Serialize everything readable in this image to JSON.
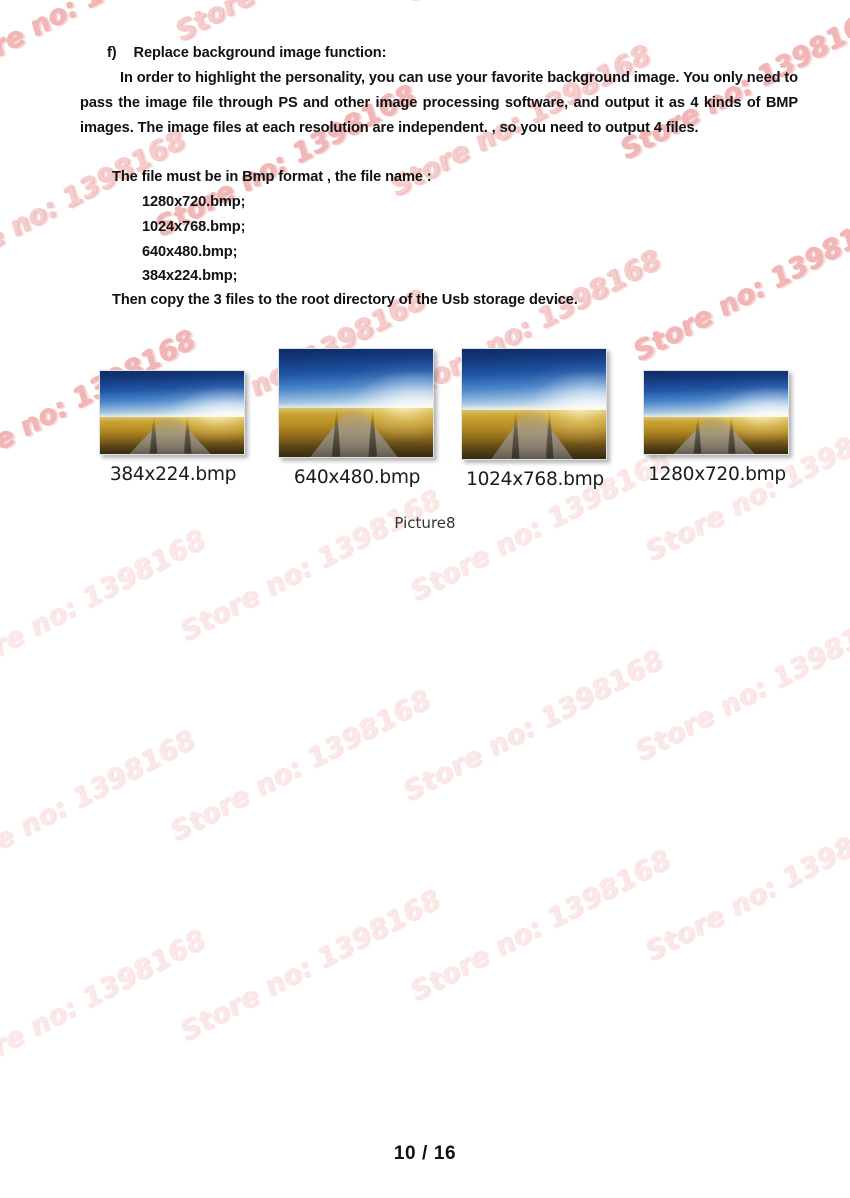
{
  "document": {
    "section_marker": "f)",
    "section_title": "Replace background image function:",
    "paragraph_1": "In order to highlight the personality, you can use your favorite background image. You only need to pass the image file through PS and other image processing software, and output it as 4 kinds of BMP images. The image files at each resolution are independent. , so you need to output 4 files.",
    "file_format_line": "The file must be in Bmp format , the file name :",
    "file_list": [
      "1280x720.bmp;",
      "1024x768.bmp;",
      "640x480.bmp;",
      "384x224.bmp;"
    ],
    "closing_line": "Then copy the 3 files to the root directory of the Usb storage device."
  },
  "figure": {
    "label": "Picture8",
    "thumbnails": [
      {
        "caption": "384x224.bmp",
        "alt": "landscape-dirt-road-wheat-field"
      },
      {
        "caption": "640x480.bmp",
        "alt": "landscape-dirt-road-wheat-field"
      },
      {
        "caption": "1024x768.bmp",
        "alt": "landscape-dirt-road-wheat-field"
      },
      {
        "caption": "1280x720.bmp",
        "alt": "landscape-dirt-road-wheat-field"
      }
    ]
  },
  "footer": {
    "page_indicator": "10 / 16"
  },
  "watermark": {
    "text": "Store no: 1398168",
    "color": "#f3b6b6"
  },
  "colors": {
    "text": "#111111",
    "page_background": "#ffffff",
    "sky_top": "#0d2c66",
    "sky_bottom": "#f4f7f8",
    "field_top": "#d9c16a",
    "field_bottom": "#35290f",
    "watermark": "#f3b6b6"
  }
}
